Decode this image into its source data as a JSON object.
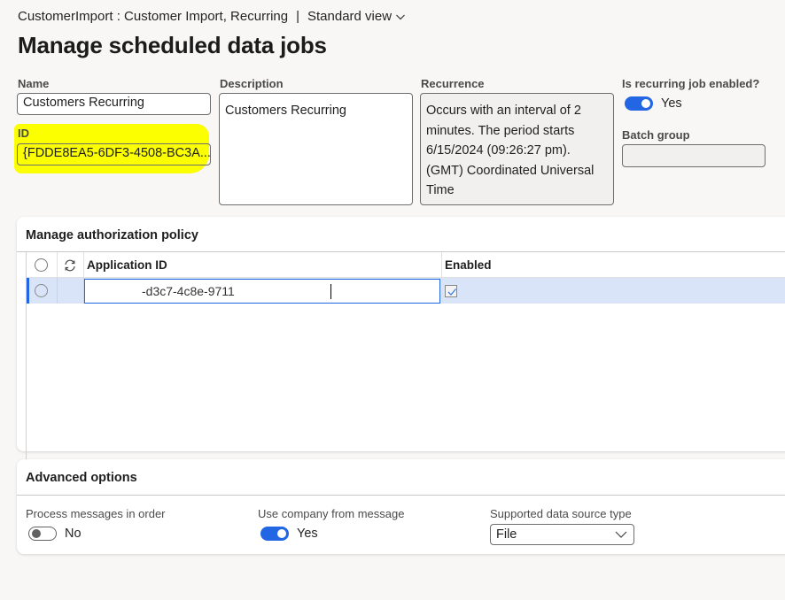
{
  "header": {
    "breadcrumb": "CustomerImport : Customer Import, Recurring",
    "separator": "|",
    "view_label": "Standard view",
    "view_icon": "chevron-down-icon",
    "title": "Manage scheduled data jobs"
  },
  "fields": {
    "name": {
      "label": "Name",
      "value": "Customers Recurring"
    },
    "id": {
      "label": "ID",
      "value": "{FDDE8EA5-6DF3-4508-BC3A..."
    },
    "description": {
      "label": "Description",
      "value": "Customers Recurring"
    },
    "recurrence": {
      "label": "Recurrence",
      "lines": [
        "Occurs with an interval of 2",
        "minutes. The period starts",
        "6/15/2024 (09:26:27 pm).",
        "(GMT) Coordinated Universal",
        "Time"
      ]
    },
    "recurring_enabled": {
      "label": "Is recurring job enabled?",
      "value": "Yes",
      "on": true
    },
    "batch_group": {
      "label": "Batch group",
      "value": ""
    }
  },
  "authorization": {
    "title": "Manage authorization policy",
    "columns": [
      "Application ID",
      "Enabled"
    ],
    "header_icons": [
      "select-all-radio",
      "refresh-icon"
    ],
    "rows": [
      {
        "application_id": "-d3c7-4c8e-9711",
        "enabled": true
      }
    ]
  },
  "advanced": {
    "title": "Advanced options",
    "process_in_order": {
      "label": "Process messages in order",
      "value": "No",
      "on": false
    },
    "use_company": {
      "label": "Use company from message",
      "value": "Yes",
      "on": true
    },
    "data_source_type": {
      "label": "Supported data source type",
      "value": "File"
    }
  },
  "colors": {
    "accent": "#2266e3",
    "highlight": "#fbff00",
    "selected_row": "#d9e4f8",
    "background": "#f8f7f6"
  }
}
